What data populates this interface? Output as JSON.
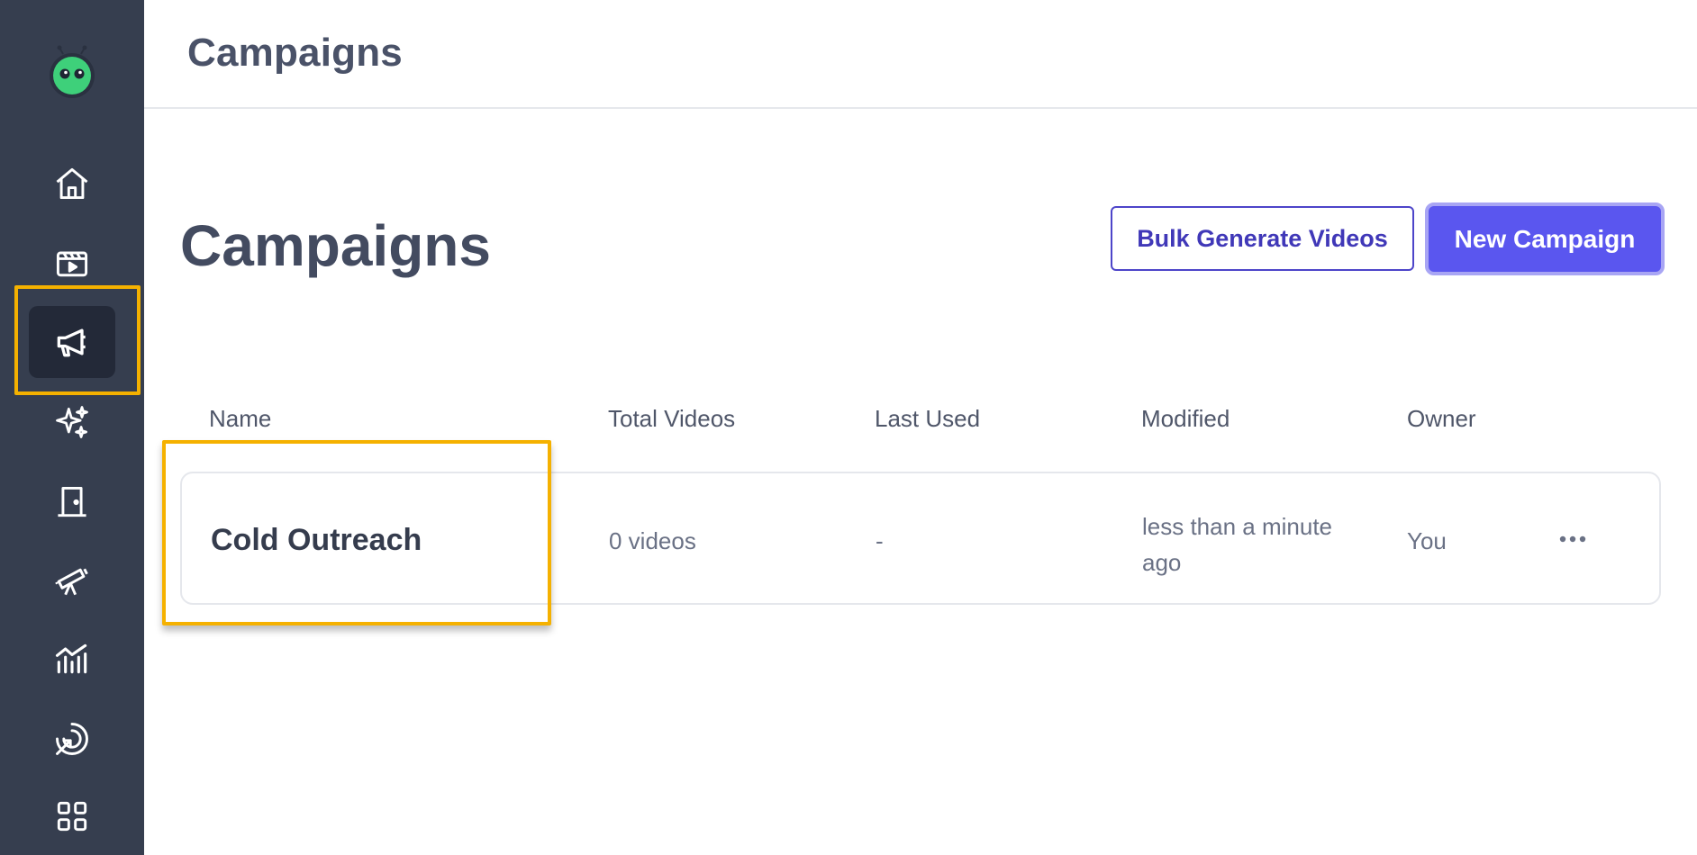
{
  "topbar": {
    "title": "Campaigns"
  },
  "page": {
    "title": "Campaigns"
  },
  "actions": {
    "bulk_label": "Bulk Generate Videos",
    "new_label": "New Campaign"
  },
  "sidebar": {
    "items": [
      {
        "icon": "home-icon"
      },
      {
        "icon": "video-library-icon"
      },
      {
        "icon": "megaphone-icon",
        "active": true
      },
      {
        "icon": "sparkles-icon"
      },
      {
        "icon": "door-icon"
      },
      {
        "icon": "telescope-icon"
      },
      {
        "icon": "analytics-icon"
      },
      {
        "icon": "target-cursor-icon"
      },
      {
        "icon": "apps-grid-icon"
      }
    ]
  },
  "table": {
    "columns": [
      "Name",
      "Total Videos",
      "Last Used",
      "Modified",
      "Owner"
    ],
    "rows": [
      {
        "name": "Cold Outreach",
        "total_videos": "0 videos",
        "last_used": "-",
        "modified_line1": "less than a minute",
        "modified_line2": "ago",
        "owner": "You"
      }
    ]
  },
  "colors": {
    "sidebar_bg": "#363e4f",
    "accent": "#5a56ef",
    "highlight": "#f5b100"
  }
}
